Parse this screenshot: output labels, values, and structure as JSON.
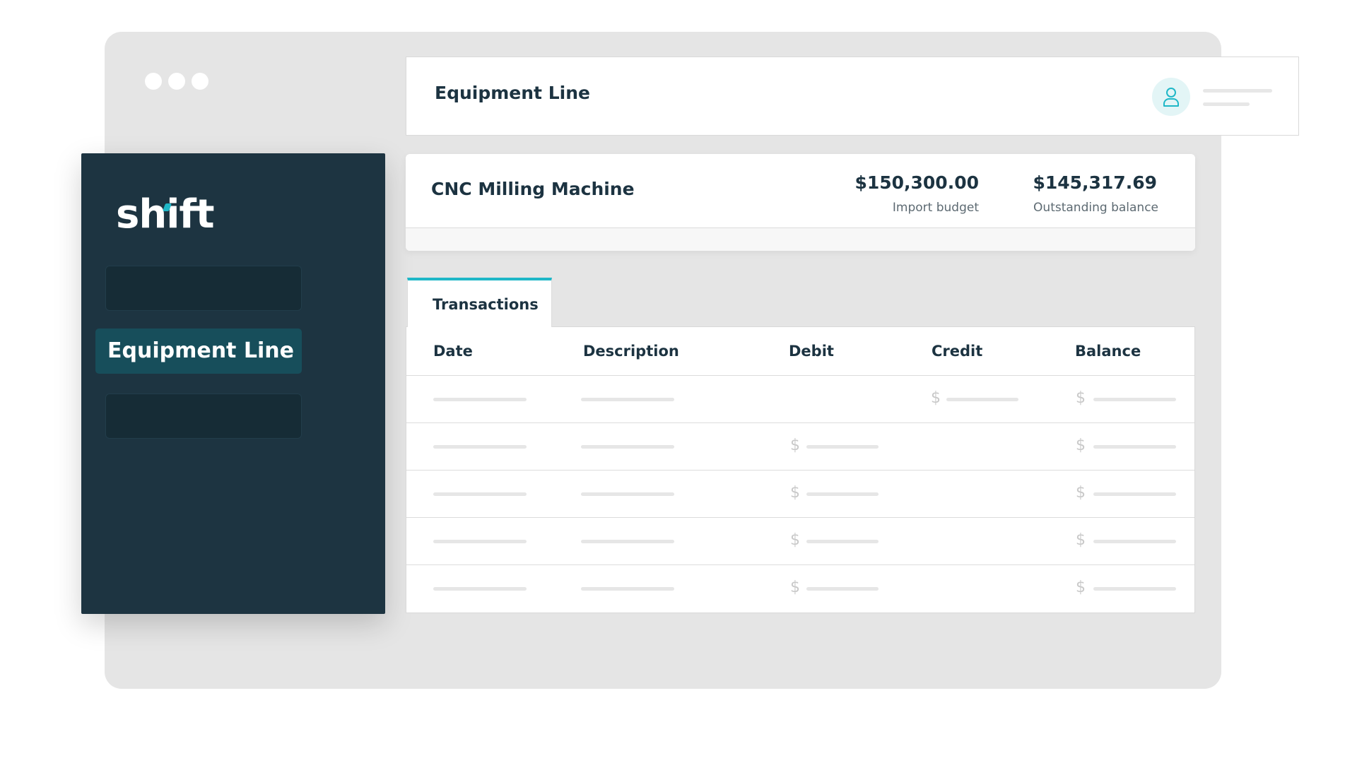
{
  "header": {
    "title": "Equipment Line"
  },
  "sidebar": {
    "logo": "shift",
    "active_item": "Equipment Line"
  },
  "summary": {
    "title": "CNC Milling Machine",
    "import_budget": "$150,300.00",
    "import_budget_label": "Import budget",
    "outstanding_balance": "$145,317.69",
    "outstanding_balance_label": "Outstanding balance"
  },
  "tabs": [
    {
      "label": "Transactions"
    }
  ],
  "table": {
    "columns": [
      "Date",
      "Description",
      "Debit",
      "Credit",
      "Balance"
    ],
    "currency_symbol": "$"
  },
  "colors": {
    "sidebar": "#1d3441",
    "accent": "#1fb7c7",
    "active_nav": "#174e5b"
  },
  "icons": {
    "avatar": "user-icon"
  }
}
